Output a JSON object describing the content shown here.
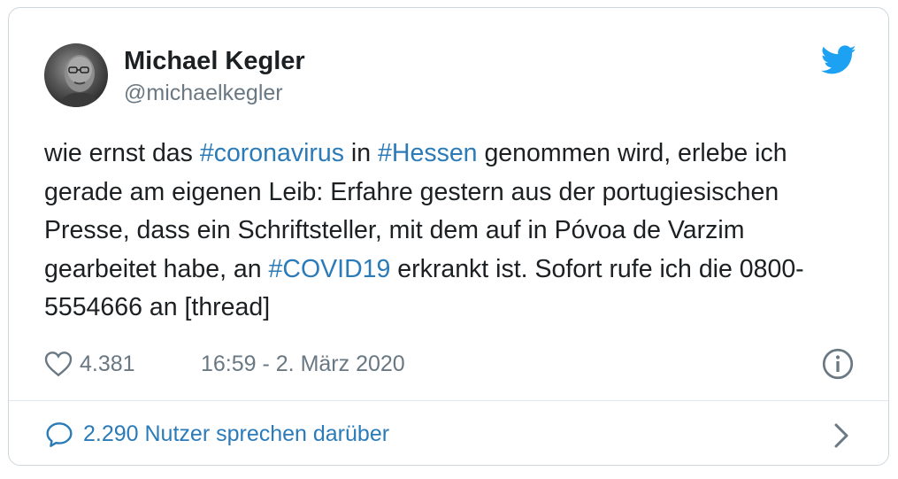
{
  "author": {
    "name": "Michael Kegler",
    "handle": "@michaelkegler"
  },
  "tweet": {
    "segments": [
      {
        "text": "wie ernst das ",
        "hashtag": false
      },
      {
        "text": "#coronavirus",
        "hashtag": true
      },
      {
        "text": " in ",
        "hashtag": false
      },
      {
        "text": "#Hessen",
        "hashtag": true
      },
      {
        "text": " genommen wird, erlebe ich gerade am eigenen Leib: Erfahre gestern aus der portugiesischen Presse, dass ein Schriftsteller, mit dem auf in Póvoa de Varzim gearbeitet habe, an ",
        "hashtag": false
      },
      {
        "text": "#COVID19",
        "hashtag": true
      },
      {
        "text": " erkrankt ist. Sofort rufe ich die 0800- 5554666 an [thread]",
        "hashtag": false
      }
    ]
  },
  "meta": {
    "likes": "4.381",
    "timestamp": "16:59 - 2. März 2020"
  },
  "footer": {
    "discussion": "2.290 Nutzer sprechen darüber"
  },
  "icons": {
    "brand": "twitter-bird-icon",
    "like": "heart-icon",
    "info": "info-icon",
    "reply": "speech-bubble-icon",
    "next": "chevron-right-icon"
  },
  "colors": {
    "link": "#2b7bb9",
    "brand": "#1da1f2",
    "muted": "#697882",
    "text": "#1c2022",
    "border": "#ccd6dd"
  }
}
